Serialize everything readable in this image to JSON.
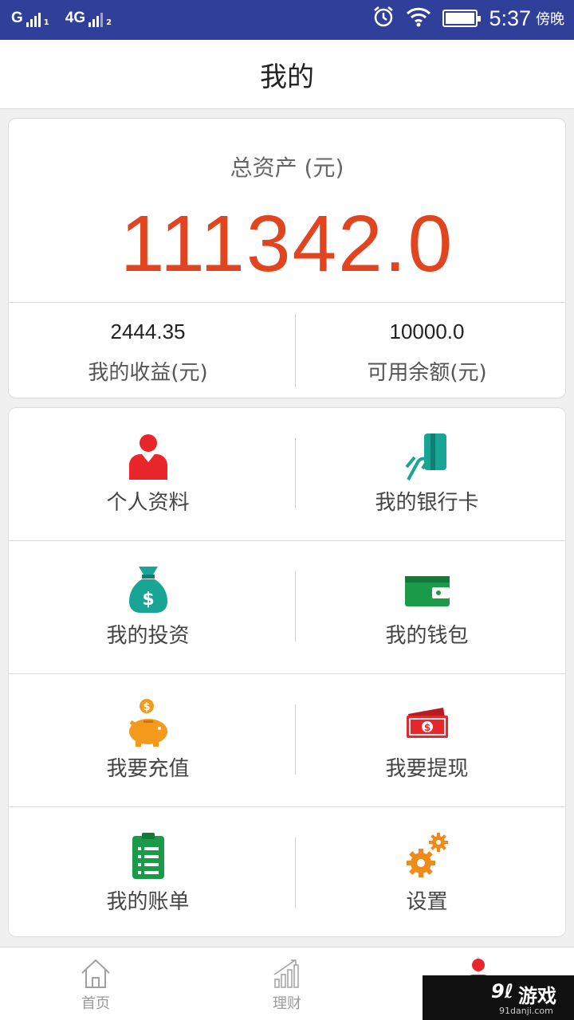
{
  "status_bar": {
    "sim1_label": "G",
    "sim1_sub": "1",
    "sim2_label": "4G",
    "sim2_sub": "2",
    "time": "5:37",
    "period": "傍晚",
    "icons": [
      "alarm-icon",
      "wifi-icon",
      "battery-icon"
    ]
  },
  "header": {
    "title": "我的"
  },
  "assets": {
    "total_label": "总资产 (元)",
    "total_value": "111342.0",
    "earnings_value": "2444.35",
    "earnings_label": "我的收益(元)",
    "balance_value": "10000.0",
    "balance_label": "可用余额(元)"
  },
  "menu": {
    "items": [
      {
        "label": "个人资料",
        "icon": "person-icon",
        "color": "#e8262b"
      },
      {
        "label": "我的银行卡",
        "icon": "bank-card-icon",
        "color": "#18a596"
      },
      {
        "label": "我的投资",
        "icon": "money-bag-icon",
        "color": "#18a596"
      },
      {
        "label": "我的钱包",
        "icon": "wallet-icon",
        "color": "#1b9a4a"
      },
      {
        "label": "我要充值",
        "icon": "piggy-bank-icon",
        "color": "#f39a1c"
      },
      {
        "label": "我要提现",
        "icon": "cash-icon",
        "color": "#e8262b"
      },
      {
        "label": "我的账单",
        "icon": "clipboard-icon",
        "color": "#1b9a4a"
      },
      {
        "label": "设置",
        "icon": "gear-icon",
        "color": "#f08a1a"
      }
    ]
  },
  "bottom_nav": {
    "items": [
      {
        "label": "首页",
        "icon": "home-icon"
      },
      {
        "label": "理财",
        "icon": "chart-icon"
      },
      {
        "label": "",
        "icon": "profile-icon",
        "active_color": "#e8262b"
      }
    ]
  },
  "watermark": {
    "main": "游戏",
    "sub": "91danji.com"
  }
}
